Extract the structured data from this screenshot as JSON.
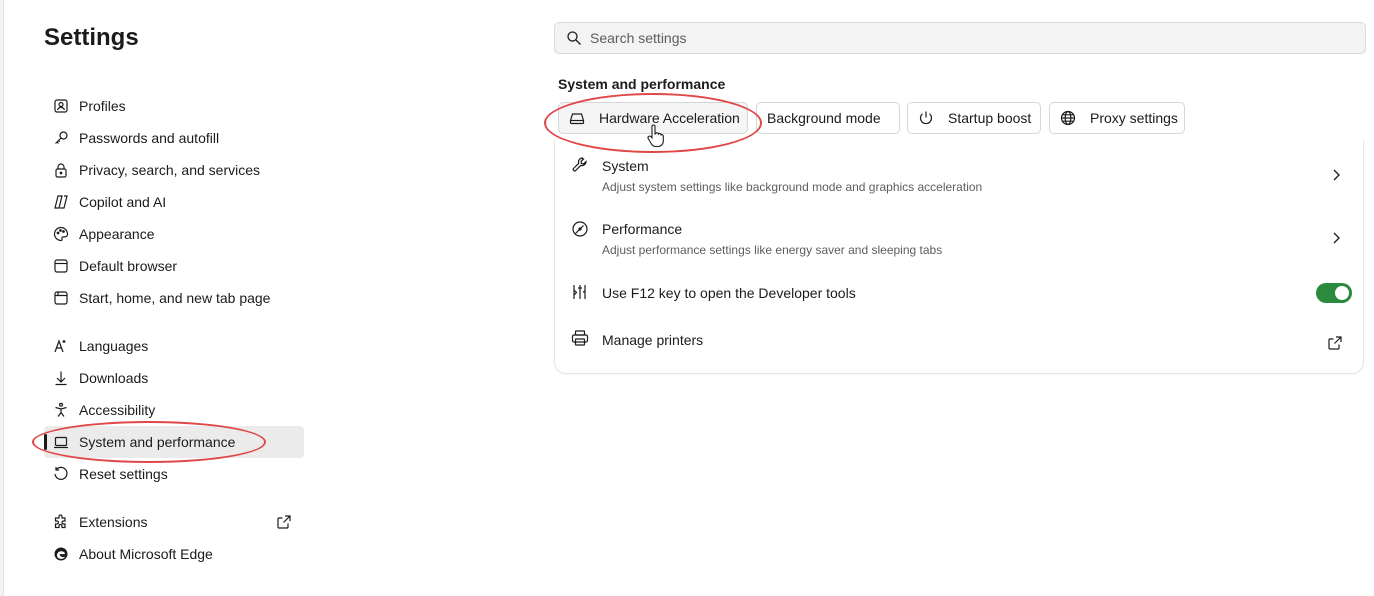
{
  "page": {
    "title": "Settings"
  },
  "sidebar": {
    "items": [
      {
        "label": "Profiles",
        "icon": "profile-card-icon"
      },
      {
        "label": "Passwords and autofill",
        "icon": "key-icon"
      },
      {
        "label": "Privacy, search, and services",
        "icon": "lock-icon"
      },
      {
        "label": "Copilot and AI",
        "icon": "copilot-icon"
      },
      {
        "label": "Appearance",
        "icon": "palette-icon"
      },
      {
        "label": "Default browser",
        "icon": "browser-window-icon"
      },
      {
        "label": "Start, home, and new tab page",
        "icon": "home-page-icon"
      },
      {
        "label": "Languages",
        "icon": "language-icon"
      },
      {
        "label": "Downloads",
        "icon": "download-icon"
      },
      {
        "label": "Accessibility",
        "icon": "accessibility-icon"
      },
      {
        "label": "System and performance",
        "icon": "laptop-icon",
        "active": true
      },
      {
        "label": "Reset settings",
        "icon": "reset-icon"
      },
      {
        "label": "Extensions",
        "icon": "puzzle-icon",
        "external": true
      },
      {
        "label": "About Microsoft Edge",
        "icon": "edge-logo-icon"
      }
    ]
  },
  "search": {
    "placeholder": "Search settings",
    "icon": "search-icon"
  },
  "main": {
    "section_title": "System and performance",
    "chips": [
      {
        "label": "Hardware Acceleration",
        "icon": "drive-icon"
      },
      {
        "label": "Background mode",
        "icon": "none"
      },
      {
        "label": "Startup boost",
        "icon": "power-icon"
      },
      {
        "label": "Proxy settings",
        "icon": "globe-icon"
      }
    ],
    "rows": [
      {
        "title": "System",
        "description": "Adjust system settings like background mode and graphics acceleration",
        "icon": "wrench-icon",
        "action": "chevron"
      },
      {
        "title": "Performance",
        "description": "Adjust performance settings like energy saver and sleeping tabs",
        "icon": "speedometer-icon",
        "action": "chevron"
      },
      {
        "title": "Use F12 key to open the Developer tools",
        "description": "",
        "icon": "developer-tools-icon",
        "action": "toggle",
        "toggle_on": true
      },
      {
        "title": "Manage printers",
        "description": "",
        "icon": "printer-icon",
        "action": "external-link"
      }
    ]
  },
  "colors": {
    "toggle_on": "#2b8a3e",
    "annotation": "#e04848",
    "active_nav_bg": "#ebebeb"
  }
}
